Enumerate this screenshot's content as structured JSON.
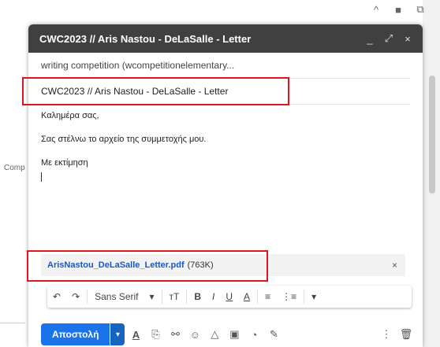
{
  "window": {
    "title": "CWC2023 // Aris Nastou - DeLaSalle - Letter",
    "controls": [
      "_",
      "⤢",
      "×"
    ]
  },
  "background": {
    "partial_label": "Comp",
    "top_icons": [
      "^",
      "■",
      "⧉"
    ]
  },
  "fields": {
    "to": "writing competition (wcompetitionelementary...",
    "subject": "CWC2023 // Aris Nastou - DeLaSalle - Letter"
  },
  "body": {
    "lines": [
      "Καλημέρα σας,",
      "Σας στέλνω το αρχείο της συμμετοχής μου.",
      "Με εκτίμηση"
    ]
  },
  "attachment": {
    "filename": "ArisNastou_DeLaSalle_Letter.pdf",
    "size": "(763K)",
    "remove": "×"
  },
  "format_toolbar": {
    "undo": "↶",
    "redo": "↷",
    "font": "Sans Serif",
    "font_caret": "▾",
    "size": "тT",
    "bold": "B",
    "italic": "I",
    "underline": "U",
    "text_color": "A",
    "align": "≡",
    "list": "⋮≡",
    "more": "▾"
  },
  "bottom_toolbar": {
    "send_label": "Αποστολή",
    "send_menu": "▾",
    "icons": [
      "A",
      "⎘",
      "⚯",
      "☺",
      "△",
      "▣",
      "◔",
      "✎"
    ],
    "more_options": "⋮",
    "delete": "🗑"
  },
  "colors": {
    "titlebar": "#404040",
    "send": "#1a73e8",
    "link": "#1a57c7",
    "highlight": "#e0141e"
  }
}
